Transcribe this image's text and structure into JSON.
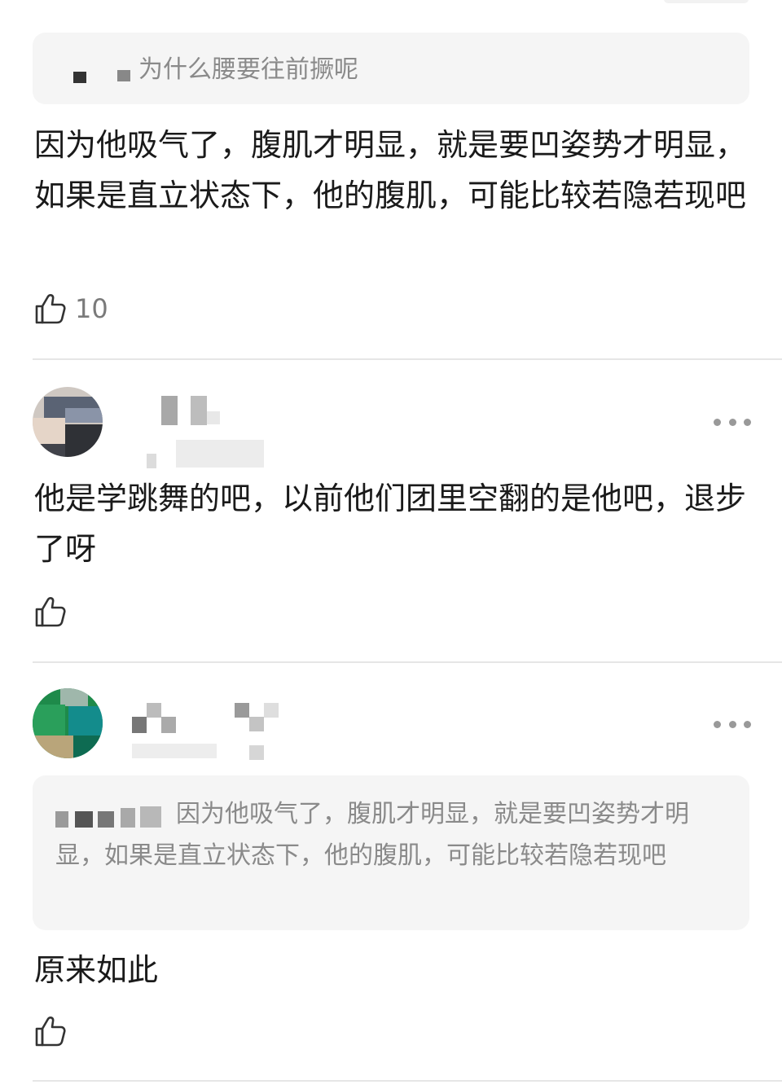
{
  "comment1": {
    "reply_quote": "为什么腰要往前撅呢",
    "text": "因为他吸气了，腹肌才明显，就是要凹姿势才明显，如果是直立状态下，他的腹肌，可能比较若隐若现吧",
    "likes": "10"
  },
  "comment2": {
    "text": "他是学跳舞的吧，以前他们团里空翻的是他吧，退步了呀"
  },
  "comment3": {
    "reply_quote": "因为他吸气了，腹肌才明显，就是要凹姿势才明显，如果是直立状态下，他的腹肌，可能比较若隐若现吧",
    "text": "原来如此"
  },
  "icons": {
    "like": "thumbs-up-icon",
    "more": "more-dots-icon"
  },
  "colors": {
    "quote_bg": "#f5f5f5",
    "quote_text": "#8a8a8a",
    "divider": "#e6e6e6"
  }
}
